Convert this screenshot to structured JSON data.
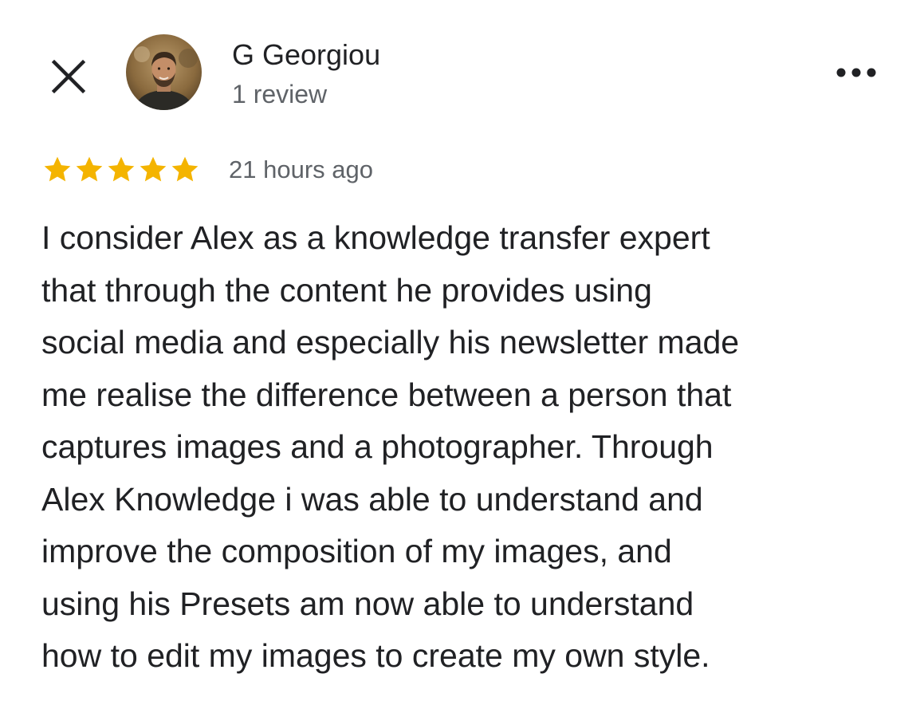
{
  "header": {
    "close_icon": "close-icon",
    "avatar_icon": "profile-photo",
    "user_name": "G Georgiou",
    "review_count": "1 review",
    "more_icon": "more-horizontal-icon"
  },
  "review": {
    "rating": 5,
    "max_rating": 5,
    "star_color": "#f4b400",
    "time_ago": "21 hours ago",
    "lines": [
      "I consider Alex as a knowledge transfer expert",
      "that through the content he provides using",
      "social media and especially his newsletter made",
      "me realise the difference between a person that",
      "captures images and a photographer. Through",
      "Alex Knowledge i was able to understand and",
      "improve the composition of my images, and",
      "using his Presets am now able to understand",
      "how to edit my images to create my own style."
    ]
  }
}
